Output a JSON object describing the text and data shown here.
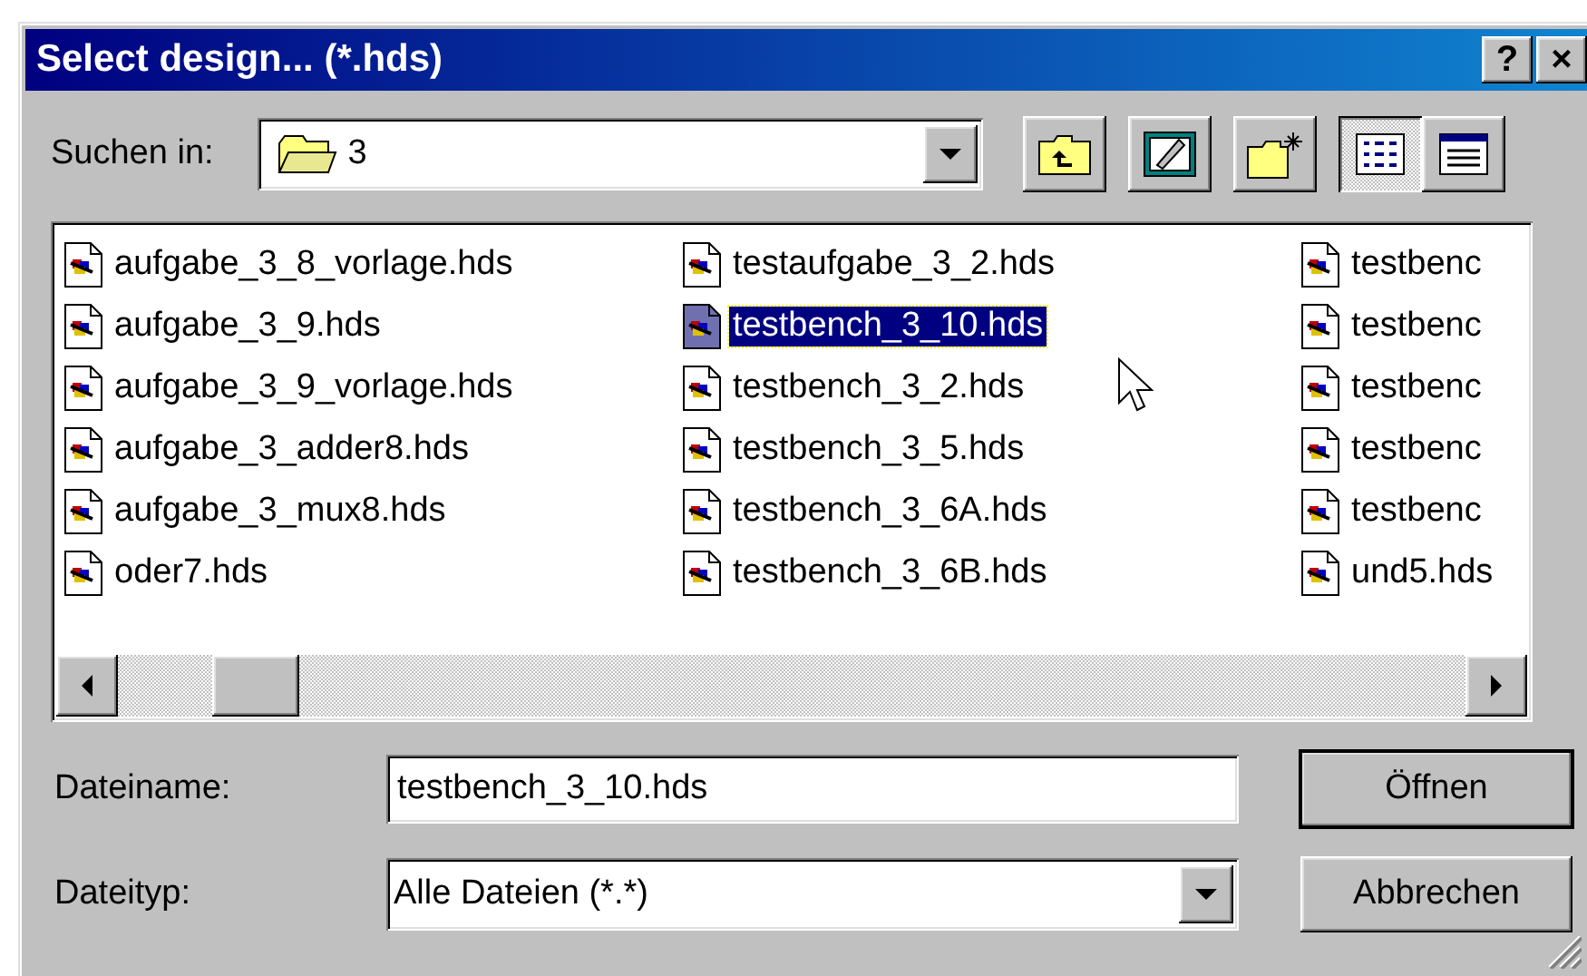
{
  "window": {
    "title": "Select design... (*.hds)",
    "buttons": [
      "?",
      "×"
    ]
  },
  "look_in": {
    "label": "Suchen in:",
    "value": "3"
  },
  "toolbar": [
    {
      "kind": "up"
    },
    {
      "kind": "desktop"
    },
    {
      "kind": "new-folder"
    },
    {
      "kind": "list",
      "selected": true
    },
    {
      "kind": "details",
      "selected": false
    }
  ],
  "files": [
    {
      "name": "aufgabe_3_8_vorlage.hds",
      "selected": false
    },
    {
      "name": "aufgabe_3_9.hds",
      "selected": false
    },
    {
      "name": "aufgabe_3_9_vorlage.hds",
      "selected": false
    },
    {
      "name": "aufgabe_3_adder8.hds",
      "selected": false
    },
    {
      "name": "aufgabe_3_mux8.hds",
      "selected": false
    },
    {
      "name": "oder7.hds",
      "selected": false
    },
    {
      "name": "testaufgabe_3_2.hds",
      "selected": false
    },
    {
      "name": "testbench_3_10.hds",
      "selected": true
    },
    {
      "name": "testbench_3_2.hds",
      "selected": false
    },
    {
      "name": "testbench_3_5.hds",
      "selected": false
    },
    {
      "name": "testbench_3_6A.hds",
      "selected": false
    },
    {
      "name": "testbench_3_6B.hds",
      "selected": false
    },
    {
      "name": "testbenc",
      "selected": false
    },
    {
      "name": "testbenc",
      "selected": false
    },
    {
      "name": "testbenc",
      "selected": false
    },
    {
      "name": "testbenc",
      "selected": false
    },
    {
      "name": "testbenc",
      "selected": false
    },
    {
      "name": "und5.hds",
      "selected": false
    }
  ],
  "file_name": {
    "label": "Dateiname:",
    "value": "testbench_3_10.hds"
  },
  "file_type": {
    "label": "Dateityp:",
    "value": "Alle Dateien (*.*)"
  },
  "buttons": [
    {
      "label": "Öffnen",
      "default": true
    },
    {
      "label": "Abbrechen",
      "default": false
    }
  ]
}
